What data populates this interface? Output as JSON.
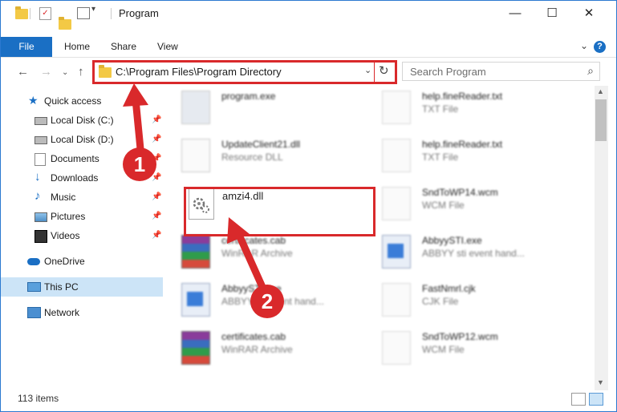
{
  "window": {
    "title": "Program"
  },
  "ribbon": {
    "tabs": [
      "File",
      "Home",
      "Share",
      "View"
    ]
  },
  "address": {
    "path": "C:\\Program Files\\Program Directory"
  },
  "search": {
    "placeholder": "Search Program"
  },
  "nav": {
    "items": [
      {
        "label": "Quick access",
        "icon": "star-icon"
      },
      {
        "label": "Local Disk (C:)",
        "icon": "drive-icon",
        "pinned": true
      },
      {
        "label": "Local Disk (D:)",
        "icon": "drive-icon",
        "pinned": true
      },
      {
        "label": "Documents",
        "icon": "documents-icon",
        "pinned": true
      },
      {
        "label": "Downloads",
        "icon": "download-icon",
        "pinned": true
      },
      {
        "label": "Music",
        "icon": "music-icon",
        "pinned": true
      },
      {
        "label": "Pictures",
        "icon": "pictures-icon",
        "pinned": true
      },
      {
        "label": "Videos",
        "icon": "videos-icon",
        "pinned": true
      },
      {
        "label": "OneDrive",
        "icon": "cloud-icon"
      },
      {
        "label": "This PC",
        "icon": "computer-icon",
        "selected": true
      },
      {
        "label": "Network",
        "icon": "network-icon"
      }
    ]
  },
  "files": [
    {
      "name": "program.exe",
      "type": "",
      "icon": "installer-icon"
    },
    {
      "name": "help.fineReader.txt",
      "type": "TXT File",
      "icon": "text-file-icon"
    },
    {
      "name": "UpdateClient21.dll",
      "type": "Resource DLL",
      "icon": "dll-icon"
    },
    {
      "name": "help.fineReader.txt",
      "type": "TXT File",
      "icon": "text-file-icon"
    },
    {
      "name": "amzi4.dll",
      "type": "",
      "icon": "dll-icon"
    },
    {
      "name": "SndToWP14.wcm",
      "type": "WCM File",
      "icon": "blank-file-icon"
    },
    {
      "name": "certificates.cab",
      "type": "WinRAR Archive",
      "icon": "winrar-icon"
    },
    {
      "name": "AbbyySTI.exe",
      "type": "ABBYY sti event hand...",
      "icon": "exe-icon"
    },
    {
      "name": "AbbyySTI.exe",
      "type": "ABBYY sti event hand...",
      "icon": "exe-icon"
    },
    {
      "name": "FastNmrl.cjk",
      "type": "CJK File",
      "icon": "blank-file-icon"
    },
    {
      "name": "certificates.cab",
      "type": "WinRAR Archive",
      "icon": "winrar-icon"
    },
    {
      "name": "SndToWP12.wcm",
      "type": "WCM File",
      "icon": "blank-file-icon"
    }
  ],
  "status": {
    "item_count": "113 items"
  },
  "annotations": {
    "step1": "1",
    "step2": "2"
  },
  "colors": {
    "accent": "#1a6fc4",
    "highlight": "#d9292b",
    "selected": "#cce4f7"
  }
}
